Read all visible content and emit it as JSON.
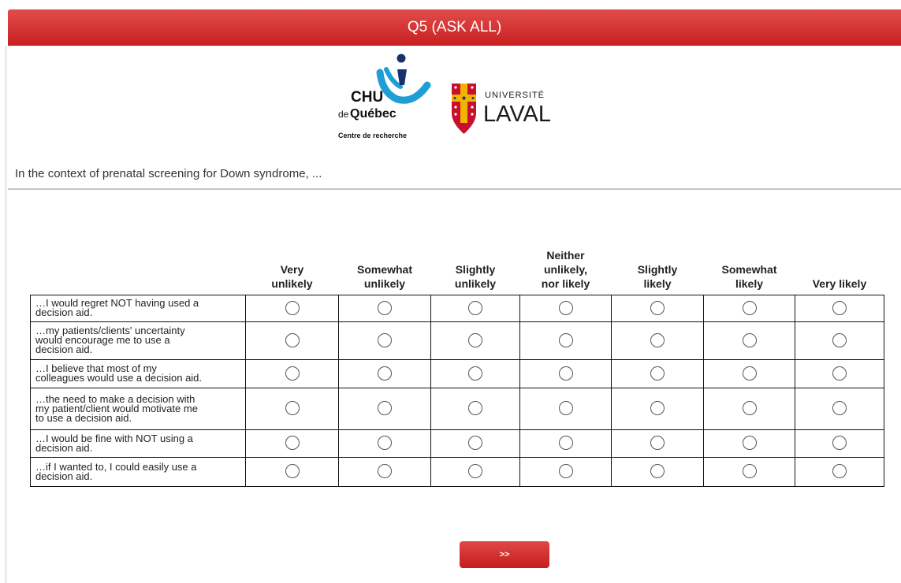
{
  "header": {
    "title": "Q5 (ASK ALL)"
  },
  "logos": {
    "chu": {
      "line1": "CHU",
      "line2_prefix": "de",
      "line2": "Québec",
      "line3": "Centre de recherche"
    },
    "laval": {
      "line1": "UNIVERSITÉ",
      "line2": "LAVAL"
    }
  },
  "intro": "In the context of prenatal screening for Down syndrome, ...",
  "scale": {
    "columns": [
      [
        "Very",
        "unlikely"
      ],
      [
        "Somewhat",
        "unlikely"
      ],
      [
        "Slightly",
        "unlikely"
      ],
      [
        "Neither",
        "unlikely,",
        "nor likely"
      ],
      [
        "Slightly",
        "likely"
      ],
      [
        "Somewhat",
        "likely"
      ],
      [
        "Very likely"
      ]
    ]
  },
  "statements": [
    [
      "…I would regret NOT having used a",
      "decision aid."
    ],
    [
      "…my patients/clients' uncertainty",
      "would encourage me to use a",
      "decision aid."
    ],
    [
      "…I believe that most of my",
      "colleagues would use a decision aid."
    ],
    [
      "…the need to make a decision with",
      "my patient/client would motivate me",
      "to use a decision aid."
    ],
    [
      "…I would be fine with NOT using a",
      "decision aid."
    ],
    [
      "…if I wanted to, I could easily use a",
      "decision aid."
    ]
  ],
  "nav": {
    "next_label": ">>"
  },
  "colors": {
    "accent": "#d42a2a",
    "chu_blue": "#1d9fd6",
    "laval_red": "#c8102e",
    "laval_gold": "#f2b400"
  }
}
